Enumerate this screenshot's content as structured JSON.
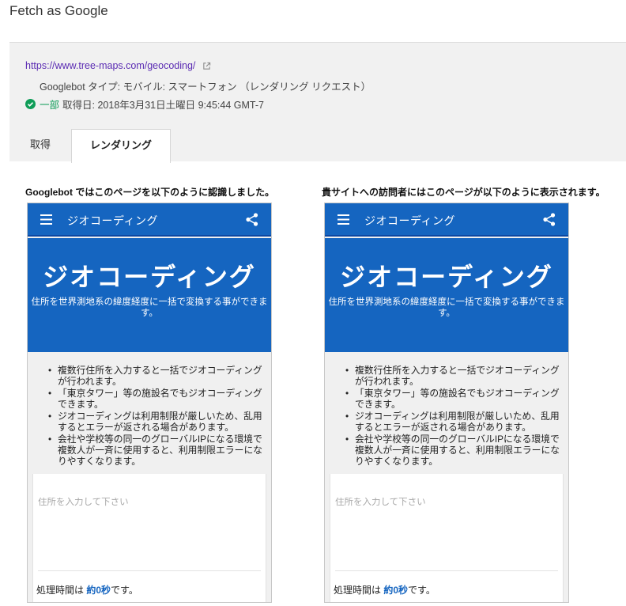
{
  "page": {
    "title": "Fetch as Google"
  },
  "info": {
    "url": "https://www.tree-maps.com/geocoding/",
    "bot_line": "Googlebot タイプ: モバイル: スマートフォン （レンダリング リクエスト）",
    "status_label": "一部",
    "fetch_date": "取得日: 2018年3月31日土曜日 9:45:44 GMT-7"
  },
  "tabs": [
    {
      "label": "取得"
    },
    {
      "label": "レンダリング"
    }
  ],
  "captions": {
    "googlebot": "Googlebot ではこのページを以下のように認識しました。",
    "visitor": "貴サイトへの訪問者にはこのページが以下のように表示されます。"
  },
  "preview": {
    "appbar_title": "ジオコーディング",
    "hero_title": "ジオコーディング",
    "hero_subtitle": "住所を世界測地系の緯度経度に一括で変換する事ができます。",
    "features": [
      "複数行住所を入力すると一括でジオコーディングが行われます。",
      "「東京タワー」等の施設名でもジオコーディングできます。",
      "ジオコーディングは利用制限が厳しいため、乱用するとエラーが返される場合があります。",
      "会社や学校等の同一のグローバルIPになる環境で複数人が一斉に使用すると、利用制限エラーになりやすくなります。"
    ],
    "input_placeholder": "住所を入力して下さい",
    "timing_prefix": "処理時間は ",
    "timing_value": "約0秒",
    "timing_suffix": "です。"
  },
  "colors": {
    "brand_blue": "#1565c0",
    "link_purple": "#5b2cb3",
    "status_green": "#0f9d58"
  },
  "icons": {
    "external": "external-link-icon",
    "status": "check-circle-icon",
    "menu": "hamburger-menu-icon",
    "share": "share-icon"
  }
}
